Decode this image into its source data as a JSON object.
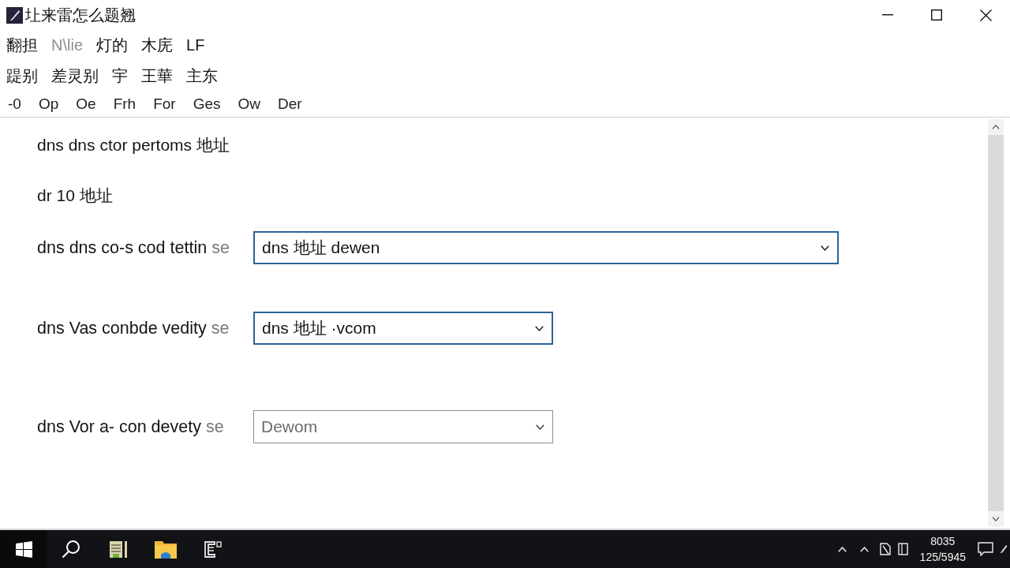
{
  "window": {
    "title": "圵来雷怎么题翘"
  },
  "menu_rows": [
    {
      "items": [
        {
          "label": "翻担",
          "disabled": false
        },
        {
          "label": "N\\lie",
          "disabled": true
        },
        {
          "label": "灯的",
          "disabled": false
        },
        {
          "label": "木庑",
          "disabled": false
        },
        {
          "label": "LF",
          "disabled": false
        }
      ]
    },
    {
      "items": [
        {
          "label": "踶别",
          "disabled": false
        },
        {
          "label": "差灵别",
          "disabled": false
        },
        {
          "label": "宇",
          "disabled": false
        },
        {
          "label": "王華",
          "disabled": false
        },
        {
          "label": "主东",
          "disabled": false
        }
      ]
    }
  ],
  "toolbar": {
    "items": [
      "-0",
      "Op",
      "Oe",
      "Frh",
      "For",
      "Ges",
      "Ow",
      "Der"
    ]
  },
  "content": {
    "headings": [
      "dns dns ctor pertoms 地址",
      "dr 10 地址"
    ],
    "settings": [
      {
        "label": "dns dns co-s cod tettin",
        "suffix": "se",
        "value": "dns 地址 dewen",
        "disabled": false
      },
      {
        "label": "dns Vas conbde vedity",
        "suffix": "se",
        "value": "dns 地址 ·vcom",
        "disabled": false
      },
      {
        "label": "dns Vor a- con devety",
        "suffix": "se",
        "value": "Dewom",
        "disabled": true
      }
    ]
  },
  "taskbar": {
    "clock": {
      "time": "8035",
      "date": "125/5945"
    }
  }
}
